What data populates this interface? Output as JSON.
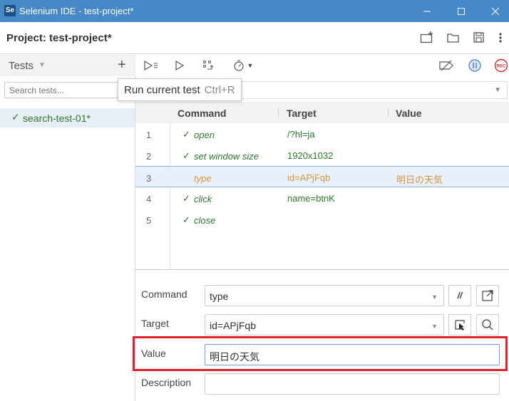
{
  "window": {
    "title": "Selenium IDE - test-project*",
    "app_icon_text": "Se"
  },
  "project": {
    "label": "Project:  test-project*"
  },
  "sidebar": {
    "header_label": "Tests",
    "search_placeholder": "Search tests...",
    "tests": [
      {
        "name": "search-test-01*",
        "status_icon": "check-icon"
      }
    ]
  },
  "tooltip": {
    "text": "Run current test",
    "shortcut": "Ctrl+R"
  },
  "table": {
    "headers": {
      "command": "Command",
      "target": "Target",
      "value": "Value"
    },
    "rows": [
      {
        "num": "1",
        "command": "open",
        "target": "/?hl=ja",
        "value": "",
        "checked": true
      },
      {
        "num": "2",
        "command": "set window size",
        "target": "1920x1032",
        "value": "",
        "checked": true
      },
      {
        "num": "3",
        "command": "type",
        "target": "id=APjFqb",
        "value": "明日の天気",
        "checked": false,
        "selected": true
      },
      {
        "num": "4",
        "command": "click",
        "target": "name=btnK",
        "value": "",
        "checked": true
      },
      {
        "num": "5",
        "command": "close",
        "target": "",
        "value": "",
        "checked": true
      }
    ]
  },
  "editor": {
    "command_label": "Command",
    "command_value": "type",
    "target_label": "Target",
    "target_value": "id=APjFqb",
    "value_label": "Value",
    "value_value": "明日の天気",
    "description_label": "Description",
    "description_value": "",
    "comment_toggle_label": "//"
  },
  "colors": {
    "titlebar": "#4788c7",
    "pass_green": "#2c7a2c",
    "selected_orange": "#d4953b",
    "highlight_red": "#e0202a",
    "rec_red": "#d42b2b"
  }
}
